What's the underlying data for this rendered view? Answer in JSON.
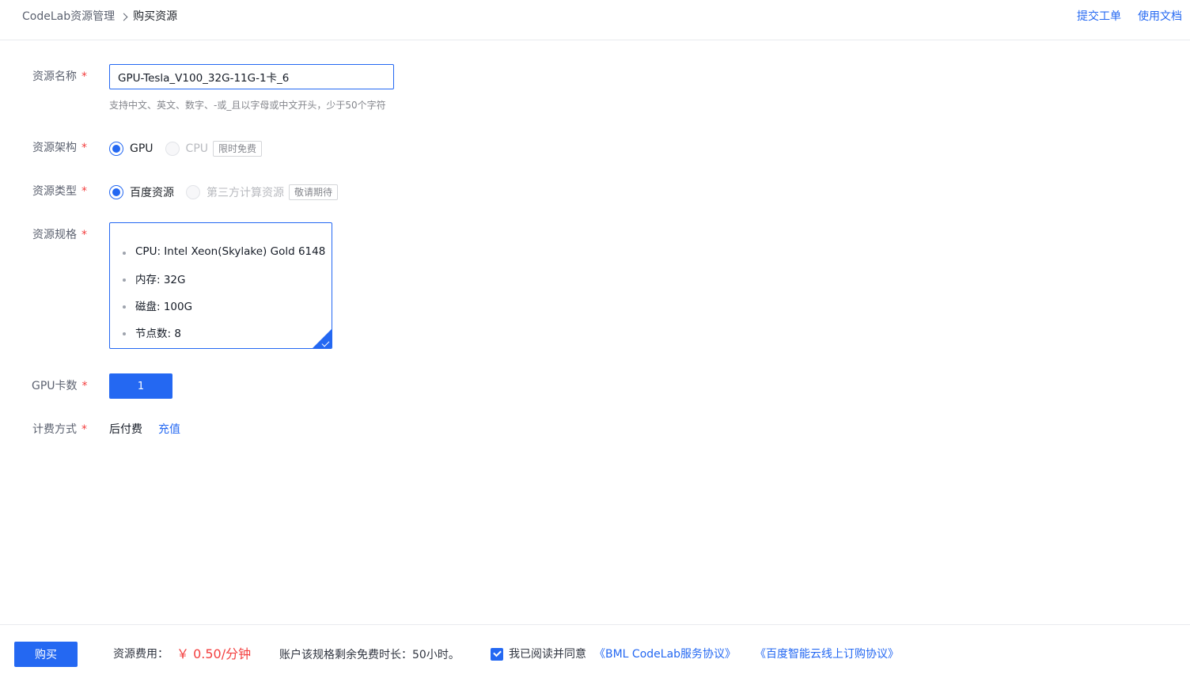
{
  "breadcrumb": {
    "root": "CodeLab资源管理",
    "current": "购买资源"
  },
  "header_links": {
    "ticket": "提交工单",
    "docs": "使用文档"
  },
  "form": {
    "required_mark": "*",
    "name": {
      "label": "资源名称",
      "value": "GPU-Tesla_V100_32G-11G-1卡_6",
      "hint": "支持中文、英文、数字、-或_且以字母或中文开头，少于50个字符"
    },
    "arch": {
      "label": "资源架构",
      "options": [
        {
          "label": "GPU",
          "selected": true,
          "disabled": false
        },
        {
          "label": "CPU",
          "selected": false,
          "disabled": true,
          "tag": "限时免费"
        }
      ]
    },
    "type": {
      "label": "资源类型",
      "options": [
        {
          "label": "百度资源",
          "selected": true,
          "disabled": false
        },
        {
          "label": "第三方计算资源",
          "selected": false,
          "disabled": true,
          "tag": "敬请期待"
        }
      ]
    },
    "spec": {
      "label": "资源规格",
      "items": [
        "CPU: Intel Xeon(Skylake) Gold 6148",
        "内存: 32G",
        "磁盘: 100G",
        "节点数: 8"
      ]
    },
    "gpu_count": {
      "label": "GPU卡数",
      "value": "1"
    },
    "billing": {
      "label": "计费方式",
      "value": "后付费",
      "recharge": "充值"
    }
  },
  "footer": {
    "buy_label": "购买",
    "fee_label": "资源费用：",
    "fee_value": "￥ 0.50/分钟",
    "free_time": "账户该规格剩余免费时长：50小时。",
    "agree_text": "我已阅读并同意",
    "agree_link_1": "《BML CodeLab服务协议》",
    "agree_link_2": "《百度智能云线上订购协议》"
  },
  "colors": {
    "accent": "#2468f2",
    "required": "#f33e3e",
    "price": "#f33e3e"
  }
}
